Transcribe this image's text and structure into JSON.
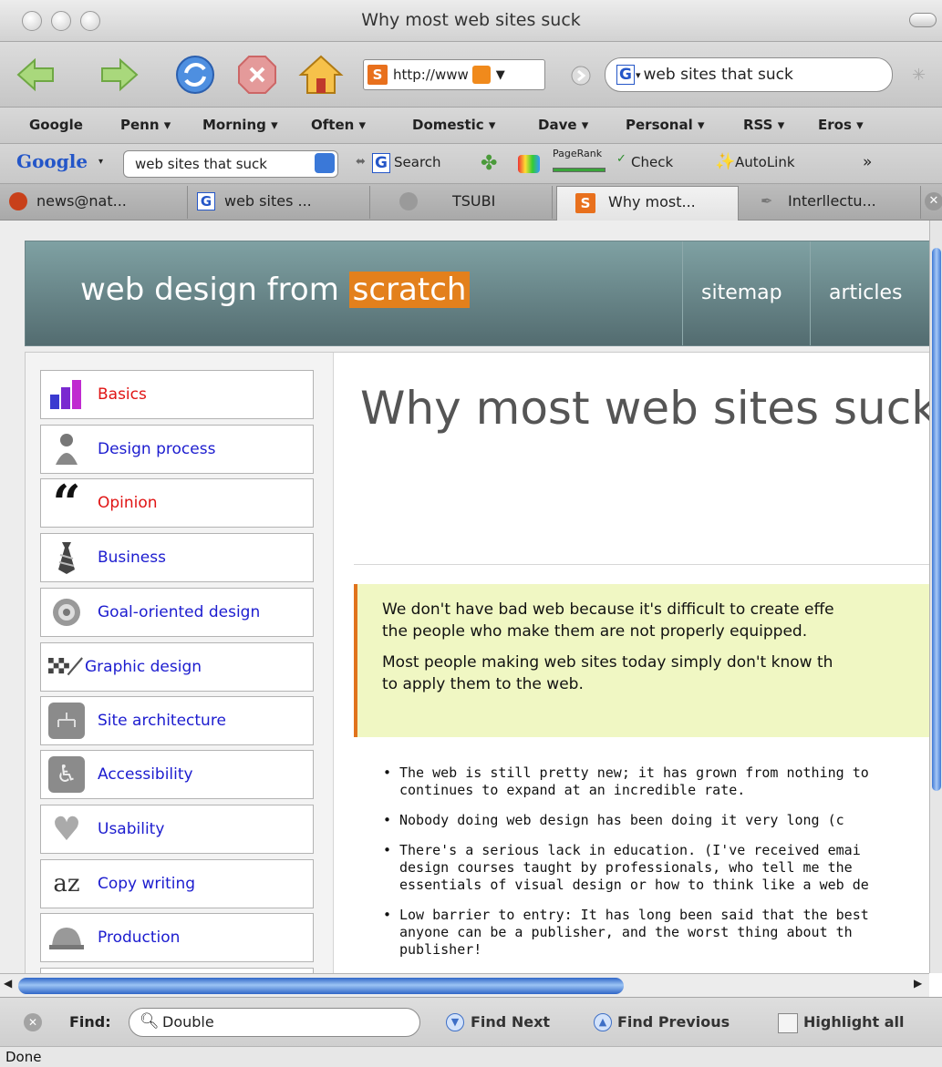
{
  "window": {
    "title": "Why most web sites suck"
  },
  "nav": {
    "url": "http://www",
    "search_value": "web sites that suck"
  },
  "bookmarks": [
    "Google",
    "Penn ▾",
    "Morning ▾",
    "Often ▾",
    "Domestic ▾",
    "Dave ▾",
    "Personal ▾",
    "RSS ▾",
    "Eros ▾"
  ],
  "google_toolbar": {
    "brand": "Google",
    "query": "web sites that suck",
    "search_label": "Search",
    "pagerank_label": "PageRank",
    "check_label": "Check",
    "autolink_label": "AutoLink"
  },
  "tabs": [
    {
      "label": "news@nat...",
      "active": false
    },
    {
      "label": "web sites ...",
      "active": false
    },
    {
      "label": "TSUBI",
      "active": false
    },
    {
      "label": "Why most...",
      "active": true
    },
    {
      "label": "Interllectu...",
      "active": false
    }
  ],
  "site": {
    "logo_main": "web design from ",
    "logo_accent": "scratch",
    "nav": [
      "sitemap",
      "articles"
    ]
  },
  "sidebar": [
    {
      "label": "Basics",
      "icon": "bar-chart-icon",
      "highlight": true
    },
    {
      "label": "Design process",
      "icon": "buddha-icon",
      "highlight": false
    },
    {
      "label": "Opinion",
      "icon": "quote-icon",
      "highlight": true
    },
    {
      "label": "Business",
      "icon": "tie-icon",
      "highlight": false
    },
    {
      "label": "Goal-oriented design",
      "icon": "target-icon",
      "highlight": false
    },
    {
      "label": "Graphic design",
      "icon": "brush-icon",
      "highlight": false
    },
    {
      "label": "Site architecture",
      "icon": "sitemap-icon",
      "highlight": false
    },
    {
      "label": "Accessibility",
      "icon": "wheelchair-icon",
      "highlight": false
    },
    {
      "label": "Usability",
      "icon": "heart-icon",
      "highlight": false
    },
    {
      "label": "Copy writing",
      "icon": "az-icon",
      "highlight": false
    },
    {
      "label": "Production",
      "icon": "hardhat-icon",
      "highlight": false
    }
  ],
  "article": {
    "title": "Why most web sites suck",
    "callout": [
      "We don't have bad web because it's difficult to create effe",
      "the people who make them are not properly equipped.",
      "Most people making web sites today simply don't know th",
      "to apply them to the web."
    ],
    "bullets": [
      "The web is still pretty new; it has grown from nothing to\ncontinues to expand at an incredible rate.",
      "Nobody doing web design has been doing it very long (c",
      "There's a serious lack in education. (I've received emai\ndesign courses taught by professionals, who tell me the\nessentials of visual design or how to think like a web de",
      "Low barrier to entry: It has long been said that the best\nanyone can be a publisher, and the worst thing about th\npublisher!"
    ]
  },
  "findbar": {
    "label": "Find:",
    "value": "Double",
    "next": "Find Next",
    "previous": "Find Previous",
    "highlight": "Highlight all"
  },
  "status": "Done",
  "colors": {
    "accent": "#e3801c",
    "link": "#1c1ccf",
    "active_link": "#e01414",
    "callout_bg": "#f0f7c3"
  }
}
